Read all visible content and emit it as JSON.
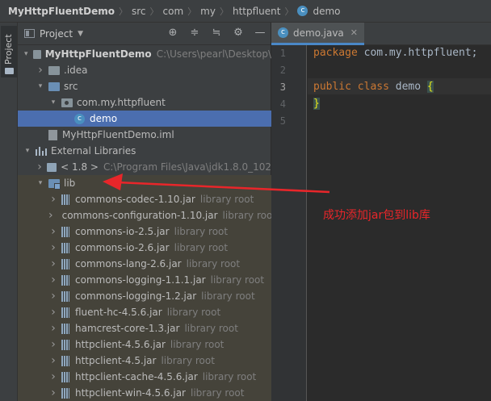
{
  "breadcrumb": {
    "items": [
      "MyHttpFluentDemo",
      "src",
      "com",
      "my",
      "httpfluent",
      "demo"
    ]
  },
  "toolstrip": {
    "project_tab": "Project"
  },
  "panel": {
    "title": "Project",
    "icons": [
      "target-icon",
      "collapse-icon",
      "expand-icon",
      "gear-icon",
      "minimize-icon"
    ]
  },
  "tree": [
    {
      "label": "MyHttpFluentDemo",
      "hint": "C:\\Users\\pearl\\Desktop\\",
      "indent": 1,
      "expanded": true,
      "icon": "folder"
    },
    {
      "label": ".idea",
      "hint": "",
      "indent": 2,
      "expanded": false,
      "icon": "folder"
    },
    {
      "label": "src",
      "hint": "",
      "indent": 2,
      "expanded": true,
      "icon": "folder-blue"
    },
    {
      "label": "com.my.httpfluent",
      "hint": "",
      "indent": 3,
      "expanded": true,
      "icon": "package"
    },
    {
      "label": "demo",
      "hint": "",
      "indent": 4,
      "expanded": null,
      "icon": "class",
      "selected": true
    },
    {
      "label": "MyHttpFluentDemo.iml",
      "hint": "",
      "indent": 2,
      "expanded": null,
      "icon": "iml"
    },
    {
      "label": "External Libraries",
      "hint": "",
      "indent": 1,
      "expanded": true,
      "icon": "extlib"
    },
    {
      "label": "< 1.8 >",
      "hint": "C:\\Program Files\\Java\\jdk1.8.0_102",
      "indent": 2,
      "expanded": false,
      "icon": "sdk"
    },
    {
      "label": "lib",
      "hint": "",
      "indent": 2,
      "expanded": true,
      "icon": "libfolder"
    },
    {
      "label": "commons-codec-1.10.jar",
      "hint": "library root",
      "indent": 3,
      "expanded": false,
      "icon": "jar"
    },
    {
      "label": "commons-configuration-1.10.jar",
      "hint": "library root",
      "indent": 3,
      "expanded": false,
      "icon": "jar"
    },
    {
      "label": "commons-io-2.5.jar",
      "hint": "library root",
      "indent": 3,
      "expanded": false,
      "icon": "jar"
    },
    {
      "label": "commons-io-2.6.jar",
      "hint": "library root",
      "indent": 3,
      "expanded": false,
      "icon": "jar"
    },
    {
      "label": "commons-lang-2.6.jar",
      "hint": "library root",
      "indent": 3,
      "expanded": false,
      "icon": "jar"
    },
    {
      "label": "commons-logging-1.1.1.jar",
      "hint": "library root",
      "indent": 3,
      "expanded": false,
      "icon": "jar"
    },
    {
      "label": "commons-logging-1.2.jar",
      "hint": "library root",
      "indent": 3,
      "expanded": false,
      "icon": "jar"
    },
    {
      "label": "fluent-hc-4.5.6.jar",
      "hint": "library root",
      "indent": 3,
      "expanded": false,
      "icon": "jar"
    },
    {
      "label": "hamcrest-core-1.3.jar",
      "hint": "library root",
      "indent": 3,
      "expanded": false,
      "icon": "jar"
    },
    {
      "label": "httpclient-4.5.6.jar",
      "hint": "library root",
      "indent": 3,
      "expanded": false,
      "icon": "jar"
    },
    {
      "label": "httpclient-4.5.jar",
      "hint": "library root",
      "indent": 3,
      "expanded": false,
      "icon": "jar"
    },
    {
      "label": "httpclient-cache-4.5.6.jar",
      "hint": "library root",
      "indent": 3,
      "expanded": false,
      "icon": "jar"
    },
    {
      "label": "httpclient-win-4.5.6.jar",
      "hint": "library root",
      "indent": 3,
      "expanded": false,
      "icon": "jar"
    }
  ],
  "editor": {
    "tab_label": "demo.java",
    "line_numbers": [
      "1",
      "2",
      "3",
      "4",
      "5"
    ],
    "lines": [
      [
        {
          "t": "package ",
          "c": "kw"
        },
        {
          "t": "com.my.httpfluent;",
          "c": "tx"
        }
      ],
      [],
      [
        {
          "t": "public ",
          "c": "kw"
        },
        {
          "t": "class ",
          "c": "kw"
        },
        {
          "t": "demo ",
          "c": "cn"
        },
        {
          "t": "{",
          "c": "br"
        }
      ],
      [
        {
          "t": "}",
          "c": "br"
        }
      ],
      []
    ]
  },
  "annotation": {
    "text": "成功添加jar包到lib库",
    "color": "#e8262a"
  }
}
